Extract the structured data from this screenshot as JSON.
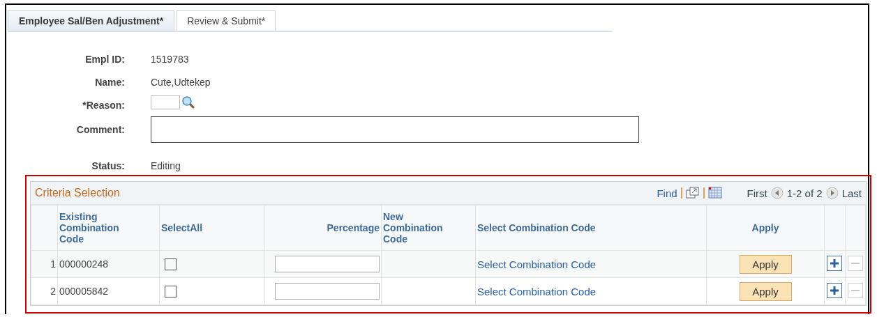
{
  "tabs": [
    {
      "label": "Employee Sal/Ben Adjustment*",
      "selected": true
    },
    {
      "label": "Review & Submit*",
      "selected": false
    }
  ],
  "fields": [
    {
      "kind": "text",
      "label": "Empl ID:",
      "value": "1519783"
    },
    {
      "kind": "text",
      "label": "Name:",
      "value": "Cute,Udtekep"
    },
    {
      "kind": "lookup",
      "label": "*Reason:"
    },
    {
      "kind": "textbox",
      "label": "Comment:"
    },
    {
      "kind": "text",
      "label": "Status:",
      "value": "Editing"
    }
  ],
  "grid": {
    "title": "Criteria Selection",
    "find": "Find",
    "first": "First",
    "range": "1-2 of 2",
    "last": "Last",
    "columns": [
      "Existing Combination Code",
      "SelectAll",
      "Percentage",
      "New Combination Code",
      "Select Combination Code",
      "Apply"
    ],
    "rows": [
      {
        "number": "1",
        "code": "000000248",
        "checked": false,
        "link": "Select Combination Code",
        "button": "Apply",
        "delete_disabled": true
      },
      {
        "number": "2",
        "code": "000005842",
        "checked": false,
        "link": "Select Combination Code",
        "button": "Apply",
        "delete_disabled": true
      }
    ]
  }
}
